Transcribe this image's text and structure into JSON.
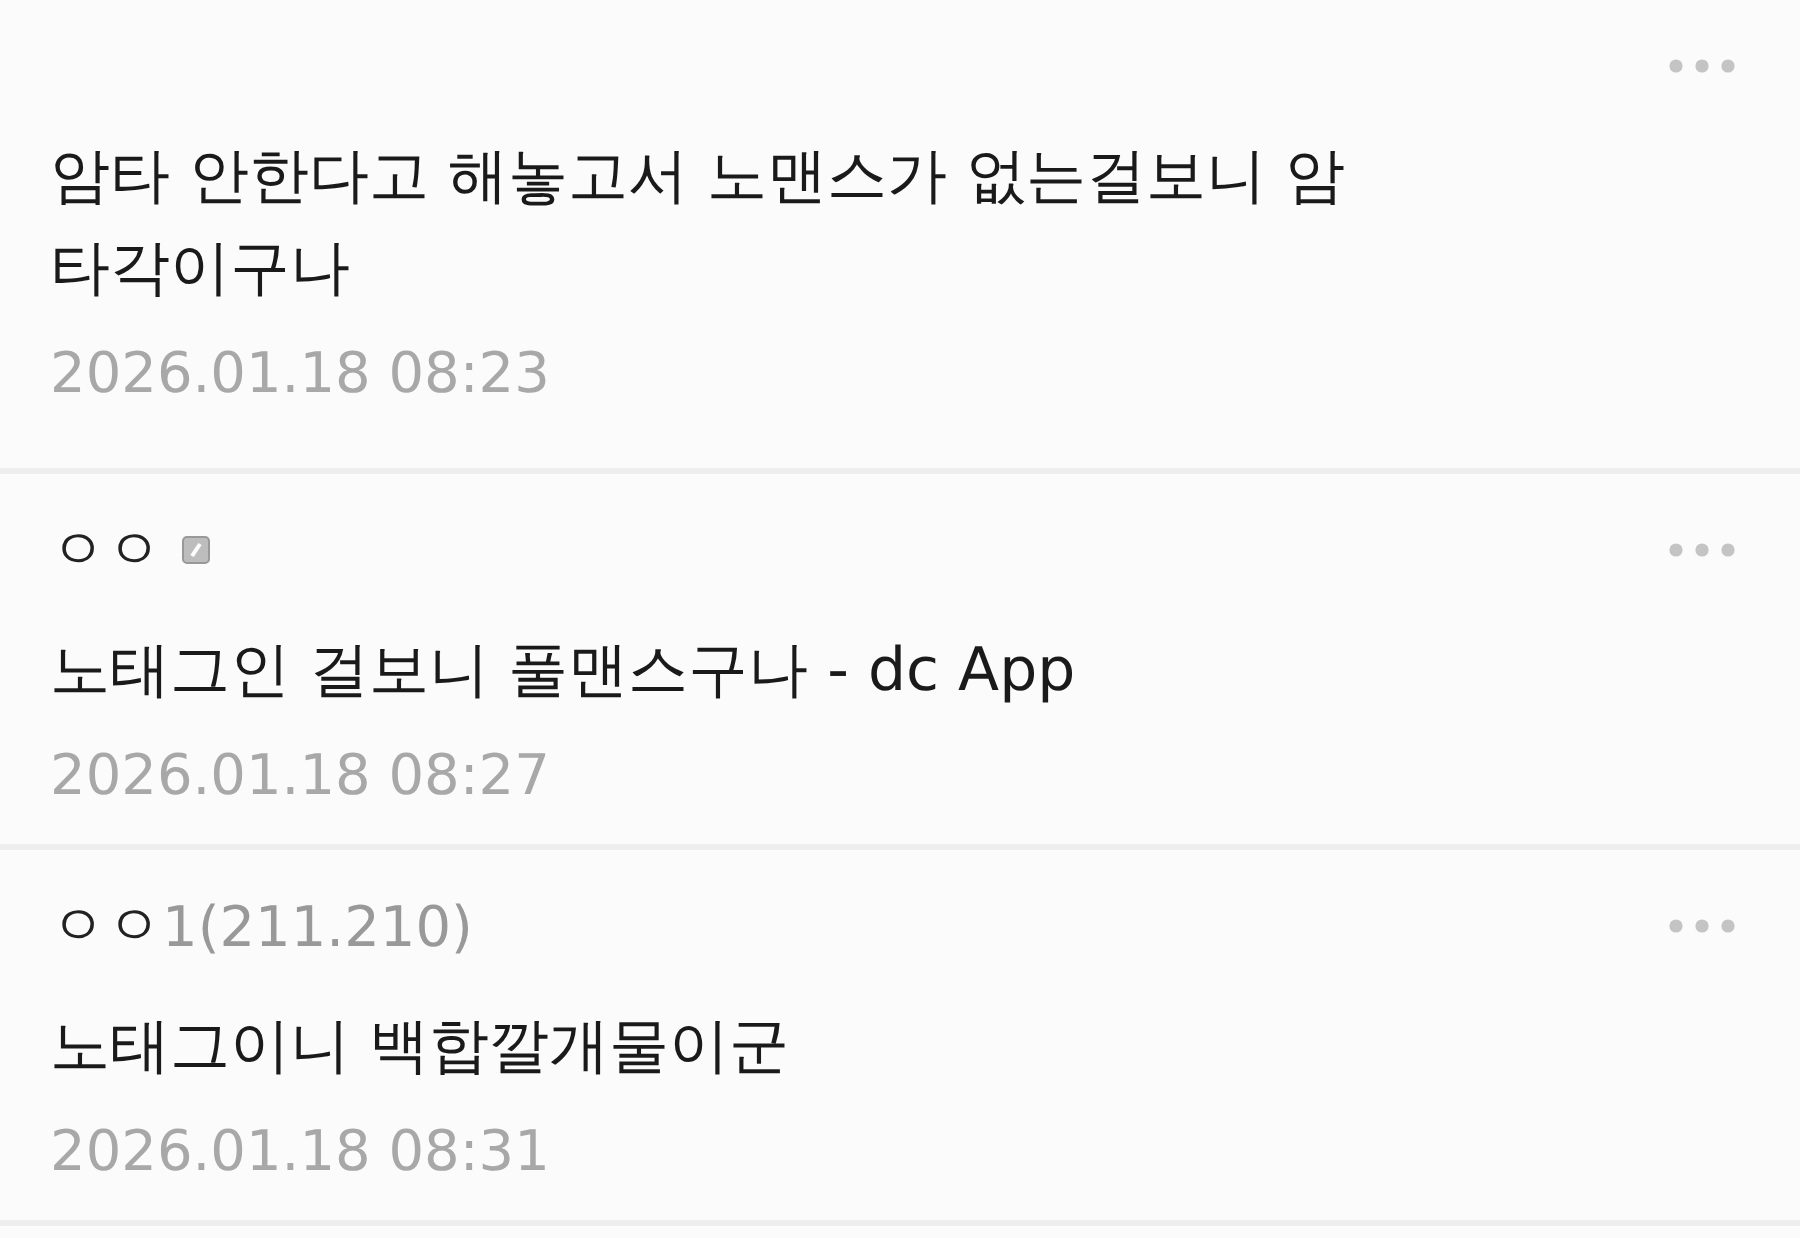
{
  "comments": [
    {
      "text": "암타 안한다고 해놓고서 노맨스가 없는걸보니 암타각이구나",
      "date": "2026.01.18 08:23",
      "nick_icon": false
    },
    {
      "name": "ㅇㅇ",
      "text": "노태그인 걸보니 풀맨스구나 - dc App",
      "date": "2026.01.18 08:27",
      "nick_icon": true
    },
    {
      "name": "ㅇㅇ",
      "ip": "1(211.210)",
      "text": "노태그이니 백합깔개물이군",
      "date": "2026.01.18 08:31",
      "nick_icon": false
    }
  ]
}
